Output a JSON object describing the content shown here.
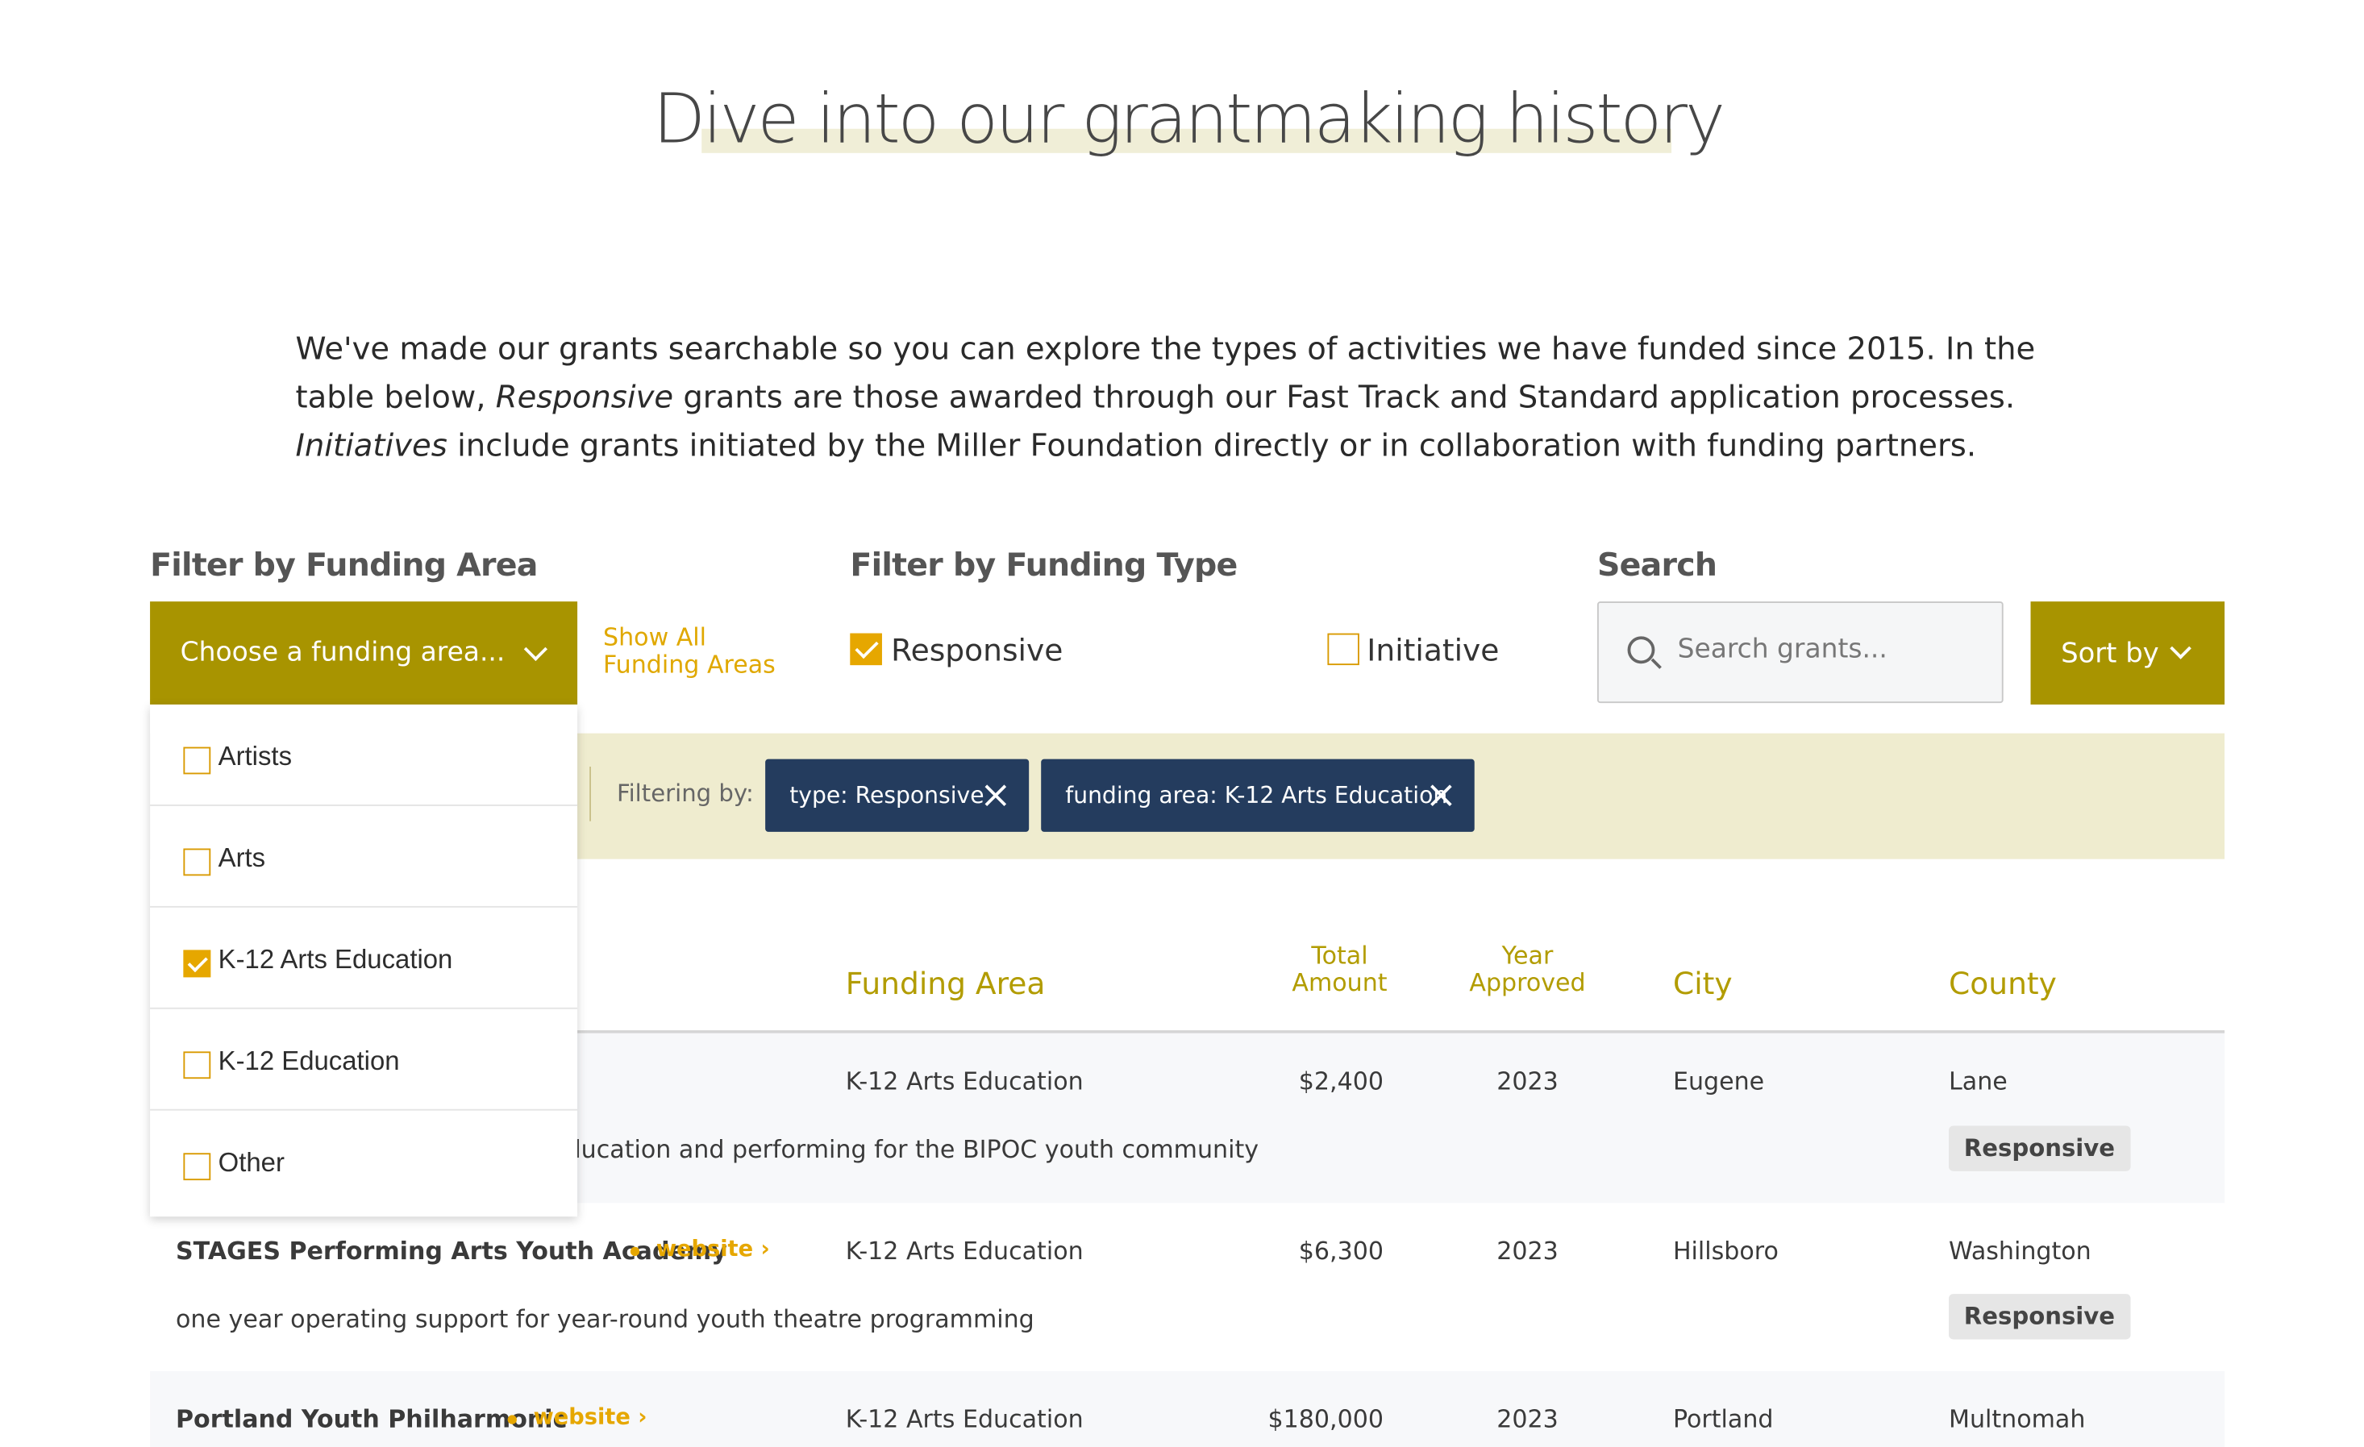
{
  "page": {
    "title": "Dive into our grantmaking history",
    "intro": {
      "p1": "We've made our grants searchable so you can explore the types of activities we have funded since 2015. In the table below, ",
      "em1": "Responsive",
      "p2": " grants are those awarded through our Fast Track and Standard application processes. ",
      "em2": "Initiatives",
      "p3": " include grants initiated by the Miller Foundation directly or in collaboration with funding partners."
    }
  },
  "filters": {
    "area_label": "Filter by Funding Area",
    "area_select": "Choose a funding area...",
    "show_all_line1": "Show All",
    "show_all_line2": "Funding Areas",
    "type_label": "Filter by Funding Type",
    "type_responsive": "Responsive",
    "type_initiative": "Initiative",
    "search_label": "Search",
    "search_placeholder": "Search grants...",
    "sort_label": "Sort by",
    "filtering_by": "Filtering by:",
    "chips": [
      "type: Responsive",
      "funding area: K-12 Arts Education"
    ]
  },
  "dropdown": {
    "items": [
      {
        "label": "Artists",
        "checked": false
      },
      {
        "label": "Arts",
        "checked": false
      },
      {
        "label": "K-12 Arts Education",
        "checked": true
      },
      {
        "label": "K-12 Education",
        "checked": false
      },
      {
        "label": "Other",
        "checked": false
      }
    ]
  },
  "table": {
    "headers": {
      "funding_area": "Funding Area",
      "total_amount_1": "Total",
      "total_amount_2": "Amount",
      "year_1": "Year",
      "year_2": "Approved",
      "city": "City",
      "county": "County"
    },
    "rows": [
      {
        "name": "",
        "website": "",
        "area": "K-12 Arts Education",
        "amount": "$2,400",
        "year": "2023",
        "city": "Eugene",
        "county": "Lane",
        "description": "lucation and performing for the BIPOC youth community",
        "type": "Responsive"
      },
      {
        "name": "STAGES Performing Arts Youth Academy",
        "website": "website ›",
        "area": "K-12 Arts Education",
        "amount": "$6,300",
        "year": "2023",
        "city": "Hillsboro",
        "county": "Washington",
        "description": "one year operating support for year-round youth theatre programming",
        "type": "Responsive"
      },
      {
        "name": "Portland Youth Philharmonic",
        "website": "website ›",
        "area": "K-12 Arts Education",
        "amount": "$180,000",
        "year": "2023",
        "city": "Portland",
        "county": "Multnomah",
        "description": "",
        "type": ""
      }
    ]
  },
  "colors": {
    "accent_olive": "#a89400",
    "accent_gold": "#e6a700",
    "chip_navy": "#243c5e",
    "filter_bar_bg": "#efeccf"
  }
}
